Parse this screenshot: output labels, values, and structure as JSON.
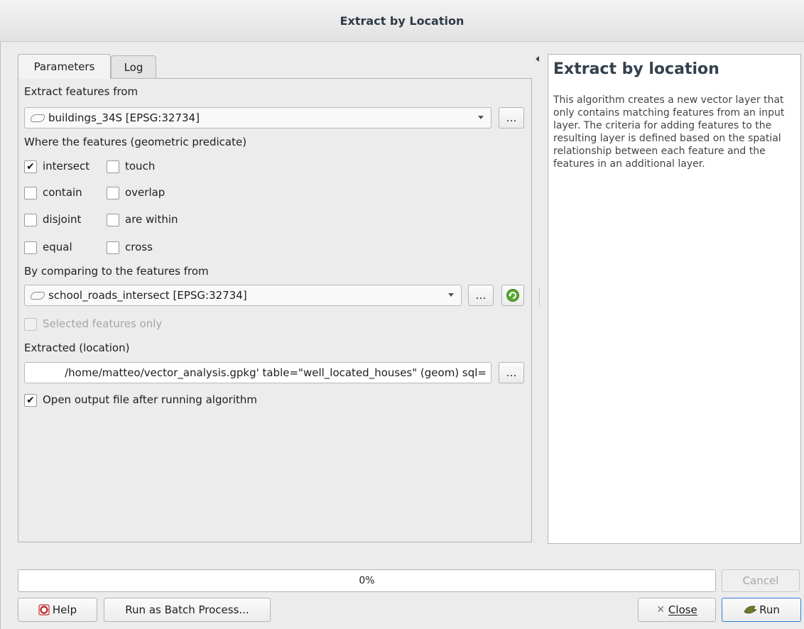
{
  "window": {
    "title": "Extract by Location"
  },
  "tabs": [
    {
      "label": "Parameters"
    },
    {
      "label": "Log"
    }
  ],
  "params": {
    "input_label": "Extract features from",
    "input_value": "buildings_34S [EPSG:32734]",
    "predicate_label": "Where the features (geometric predicate)",
    "predicates": [
      {
        "label": "intersect",
        "checked": true
      },
      {
        "label": "touch",
        "checked": false
      },
      {
        "label": "contain",
        "checked": false
      },
      {
        "label": "overlap",
        "checked": false
      },
      {
        "label": "disjoint",
        "checked": false
      },
      {
        "label": "are within",
        "checked": false
      },
      {
        "label": "equal",
        "checked": false
      },
      {
        "label": "cross",
        "checked": false
      }
    ],
    "compare_label": "By comparing to the features from",
    "compare_value": "school_roads_intersect [EPSG:32734]",
    "selected_only_label": "Selected features only",
    "output_label": "Extracted (location)",
    "output_value": "/home/matteo/vector_analysis.gpkg' table=\"well_located_houses\" (geom) sql=",
    "open_output_label": "Open output file after running algorithm",
    "browse_label": "…"
  },
  "help": {
    "title": "Extract by location",
    "body": "This algorithm creates a new vector layer that only contains matching features from an input layer. The criteria for adding features to the resulting layer is defined based on the spatial relationship between each feature and the features in an additional layer."
  },
  "progress": {
    "value": 0,
    "label": "0%"
  },
  "buttons": {
    "cancel": "Cancel",
    "help": "Help",
    "batch": "Run as Batch Process...",
    "close": "Close",
    "run": "Run"
  },
  "colors": {
    "accent": "#2a7fd4",
    "title_text": "#2f3b48"
  }
}
